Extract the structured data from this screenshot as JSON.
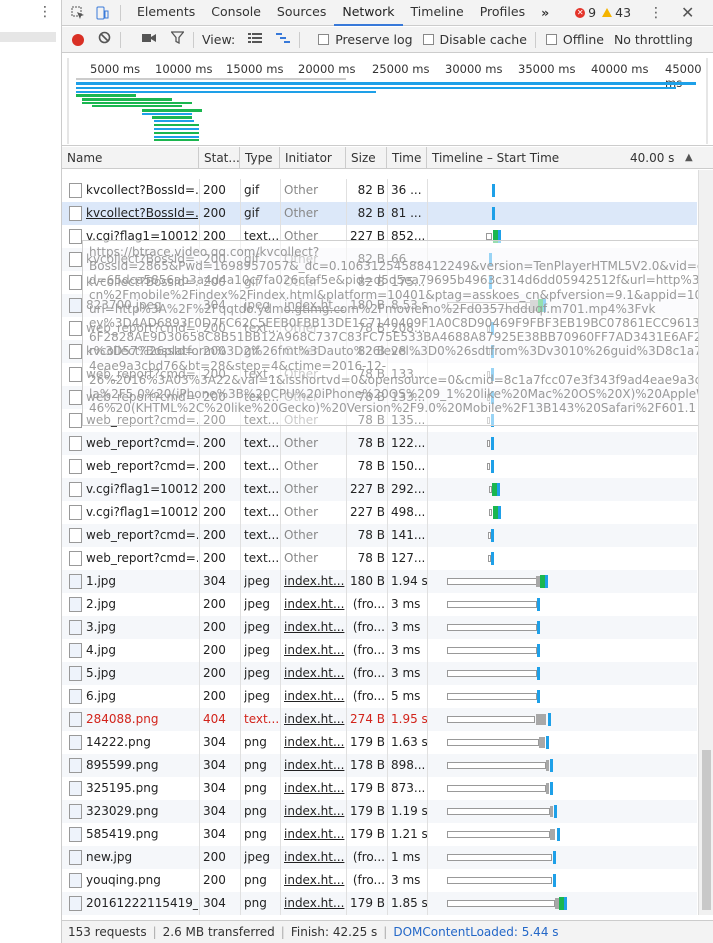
{
  "tabbar": {
    "tabs": [
      "Elements",
      "Console",
      "Sources",
      "Network",
      "Timeline",
      "Profiles"
    ],
    "active_tab": "Network",
    "more_label": "»",
    "error_count": "9",
    "warning_count": "43",
    "close_label": "✕"
  },
  "toolbar": {
    "view_label": "View:",
    "preserve_log": "Preserve log",
    "disable_cache": "Disable cache",
    "offline": "Offline",
    "throttling": "No throttling"
  },
  "overview": {
    "ticks": [
      "5000 ms",
      "10000 ms",
      "15000 ms",
      "20000 ms",
      "25000 ms",
      "30000 ms",
      "35000 ms",
      "40000 ms",
      "45000 ms"
    ]
  },
  "columns": {
    "name": "Name",
    "status": "Stat...",
    "type": "Type",
    "initiator": "Initiator",
    "size": "Size",
    "time": "Time",
    "timeline": "Timeline – Start Time",
    "timeline_end": "40.00 s",
    "sort_icon": "▲"
  },
  "rows": [
    {
      "name": "kvcollect?BossId=...",
      "status": "200",
      "type": "gif",
      "initiator": "Other",
      "size": "82 B",
      "time": "36 ..."
    },
    {
      "name": "kvcollect?BossId=...",
      "status": "200",
      "type": "gif",
      "initiator": "Other",
      "size": "82 B",
      "time": "81 ..."
    },
    {
      "name": "v.cgi?flag1=10012...",
      "status": "200",
      "type": "text...",
      "initiator": "Other",
      "size": "227 B",
      "time": "852..."
    },
    {
      "name": "kvcollect?BossId=...",
      "status": "200",
      "type": "gif",
      "initiator": "Other",
      "size": "82 B",
      "time": "66 ..."
    },
    {
      "name": "kvcollect?BossId=...",
      "status": "200",
      "type": "gif",
      "initiator": "Other",
      "size": "82 B",
      "time": "175..."
    },
    {
      "name": "823700.jpeg",
      "status": "304",
      "type": "jpeg",
      "initiator": "index.ht...",
      "size": "180 B",
      "time": "8.53 s"
    },
    {
      "name": "web_report?cmd=...",
      "status": "200",
      "type": "text...",
      "initiator": "Other",
      "size": "78 B",
      "time": "208..."
    },
    {
      "name": "kvcollect?BossId=...",
      "status": "200",
      "type": "gif",
      "initiator": "Other",
      "size": "82 B",
      "time": "28 ..."
    },
    {
      "name": "web_report?cmd=...",
      "status": "200",
      "type": "text...",
      "initiator": "Other",
      "size": "78 B",
      "time": "133..."
    },
    {
      "name": "web_report?cmd=...",
      "status": "200",
      "type": "text...",
      "initiator": "Other",
      "size": "78 B",
      "time": "133..."
    },
    {
      "name": "web_report?cmd=...",
      "status": "200",
      "type": "text...",
      "initiator": "Other",
      "size": "78 B",
      "time": "135..."
    },
    {
      "name": "web_report?cmd=...",
      "status": "200",
      "type": "text...",
      "initiator": "Other",
      "size": "78 B",
      "time": "122..."
    },
    {
      "name": "web_report?cmd=...",
      "status": "200",
      "type": "text...",
      "initiator": "Other",
      "size": "78 B",
      "time": "150..."
    },
    {
      "name": "v.cgi?flag1=10012...",
      "status": "200",
      "type": "text...",
      "initiator": "Other",
      "size": "227 B",
      "time": "292..."
    },
    {
      "name": "v.cgi?flag1=10012...",
      "status": "200",
      "type": "text...",
      "initiator": "Other",
      "size": "227 B",
      "time": "498..."
    },
    {
      "name": "web_report?cmd=...",
      "status": "200",
      "type": "text...",
      "initiator": "Other",
      "size": "78 B",
      "time": "141..."
    },
    {
      "name": "web_report?cmd=...",
      "status": "200",
      "type": "text...",
      "initiator": "Other",
      "size": "78 B",
      "time": "127..."
    },
    {
      "name": "1.jpg",
      "status": "304",
      "type": "jpeg",
      "initiator": "index.ht...",
      "size": "180 B",
      "time": "1.94 s"
    },
    {
      "name": "2.jpg",
      "status": "200",
      "type": "jpeg",
      "initiator": "index.ht...",
      "size": "(fro...",
      "time": "3 ms"
    },
    {
      "name": "3.jpg",
      "status": "200",
      "type": "jpeg",
      "initiator": "index.ht...",
      "size": "(fro...",
      "time": "3 ms"
    },
    {
      "name": "4.jpg",
      "status": "200",
      "type": "jpeg",
      "initiator": "index.ht...",
      "size": "(fro...",
      "time": "3 ms"
    },
    {
      "name": "5.jpg",
      "status": "200",
      "type": "jpeg",
      "initiator": "index.ht...",
      "size": "(fro...",
      "time": "3 ms"
    },
    {
      "name": "6.jpg",
      "status": "200",
      "type": "jpeg",
      "initiator": "index.ht...",
      "size": "(fro...",
      "time": "5 ms"
    },
    {
      "name": "284088.png",
      "status": "404",
      "type": "text...",
      "initiator": "index.ht...",
      "size": "274 B",
      "time": "1.95 s"
    },
    {
      "name": "14222.png",
      "status": "304",
      "type": "png",
      "initiator": "index.ht...",
      "size": "179 B",
      "time": "1.63 s"
    },
    {
      "name": "895599.png",
      "status": "304",
      "type": "png",
      "initiator": "index.ht...",
      "size": "178 B",
      "time": "898..."
    },
    {
      "name": "325195.png",
      "status": "304",
      "type": "png",
      "initiator": "index.ht...",
      "size": "179 B",
      "time": "873..."
    },
    {
      "name": "323029.png",
      "status": "304",
      "type": "png",
      "initiator": "index.ht...",
      "size": "179 B",
      "time": "1.19 s"
    },
    {
      "name": "585419.png",
      "status": "304",
      "type": "png",
      "initiator": "index.ht...",
      "size": "179 B",
      "time": "1.21 s"
    },
    {
      "name": "new.jpg",
      "status": "200",
      "type": "jpeg",
      "initiator": "index.ht...",
      "size": "(fro...",
      "time": "1 ms"
    },
    {
      "name": "youqing.png",
      "status": "200",
      "type": "png",
      "initiator": "index.ht...",
      "size": "(fro...",
      "time": "3 ms"
    },
    {
      "name": "20161222115419_...",
      "status": "304",
      "type": "png",
      "initiator": "index.ht...",
      "size": "179 B",
      "time": "1.85 s"
    }
  ],
  "tooltip": {
    "lines": [
      "https://btrace.video.qq.com/kvcollect?",
      "BossId=2865&Pwd=1698957057&_dc=0.10631254588412249&version=TenPlayerHTML5V2.0&vid=d0357hdduqf&ri",
      "d=65dca5856ab3a4d4a10c7fa026cfaf5e&pid=d5d5ea79695b4963c314d6dd05942512f&url=http%3A%2F%2Fasskoes.",
      "cn%2Fmobile%2Findex%2Findex.html&platform=10401&ptag=asskoes_cn&pfversion=9.1&appid=10000&val2=1&v",
      "url=http%3A%2F%2Fqqtdo.ydmo.gtimg.com%2Fmoviemo%2Fd0357hdduqf.m701.mp4%3Fvk",
      "ey%3D4AD6893F0D7FC62C5EEB0FBB13DE1C7140409F1A0C8D90469F9FBF3EB19BC07861ECC96133D41F415A95",
      "6F2828AE9D30658C8B51BB12A968C737C83FC75E533BA4688A87925E38BB70960FF7AD3431E6AF2B146E27B64%26b",
      "r%3D57%26platform%3D2%26fmt%3Dauto%26level%3D0%26sdtfrom%3Dv3010%26guid%3D8c1a7fcc07e3f343f9ad",
      "4eae9a3cbd76&bt=28&step=4&ctime=2016-12-",
      "26%2016%3A03%3A22&val=1&isshortvd=0&opensource=0&cmid=8c1a7fcc07e3f343f9ad4eae9a3cbd76&ua=Mozil",
      "la%2F5.0%20(iPhone%3B%20CPU%20iPhone%20OS%209_1%20like%20Mac%20OS%20X)%20AppleWebKit%2F601.1.",
      "46%20(KHTML%2C%20like%20Gecko)%20Version%2F9.0%20Mobile%2F13B143%20Safari%2F601.1"
    ]
  },
  "status_bar": {
    "requests": "153 requests",
    "transferred": "2.6 MB transferred",
    "finish": "Finish: 42.25 s",
    "dcl": "DOMContentLoaded: 5.44 s"
  },
  "colors": {
    "waterfall_receive": "#1ea0e8",
    "waterfall_wait": "#1ab64f",
    "error_text": "#d2241b",
    "active_tab": "#3879d9"
  }
}
